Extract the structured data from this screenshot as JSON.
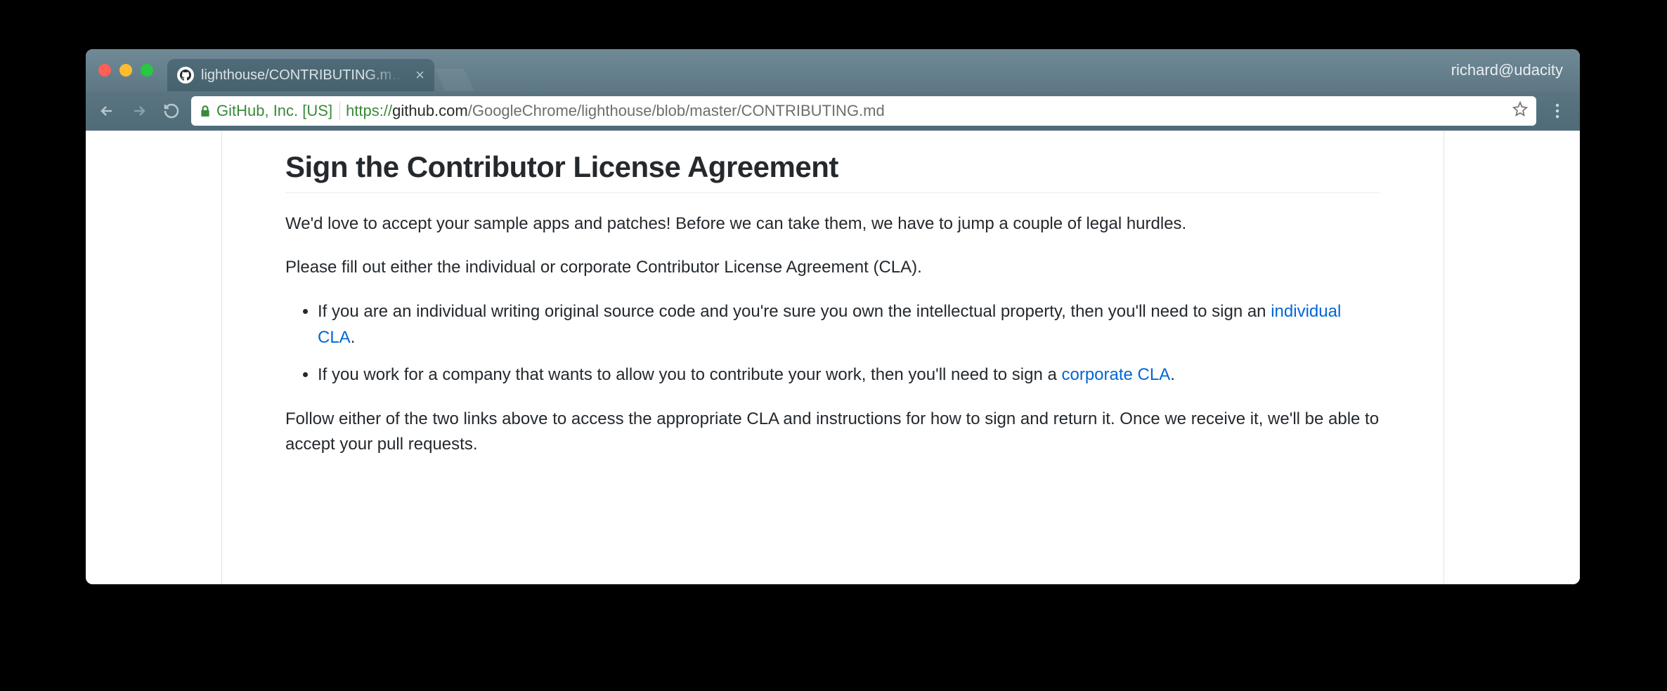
{
  "browser": {
    "tab_title": "lighthouse/CONTRIBUTING.m…",
    "profile": "richard@udacity",
    "ev_label": "GitHub, Inc. [US]",
    "url_protocol": "https://",
    "url_host": "github.com",
    "url_path": "/GoogleChrome/lighthouse/blob/master/CONTRIBUTING.md"
  },
  "page": {
    "heading": "Sign the Contributor License Agreement",
    "para1": "We'd love to accept your sample apps and patches! Before we can take them, we have to jump a couple of legal hurdles.",
    "para2": "Please fill out either the individual or corporate Contributor License Agreement (CLA).",
    "li1_a": "If you are an individual writing original source code and you're sure you own the intellectual property, then you'll need to sign an ",
    "li1_link": "individual CLA",
    "li1_b": ".",
    "li2_a": "If you work for a company that wants to allow you to contribute your work, then you'll need to sign a ",
    "li2_link": "corporate CLA",
    "li2_b": ".",
    "para3": "Follow either of the two links above to access the appropriate CLA and instructions for how to sign and return it. Once we receive it, we'll be able to accept your pull requests."
  }
}
